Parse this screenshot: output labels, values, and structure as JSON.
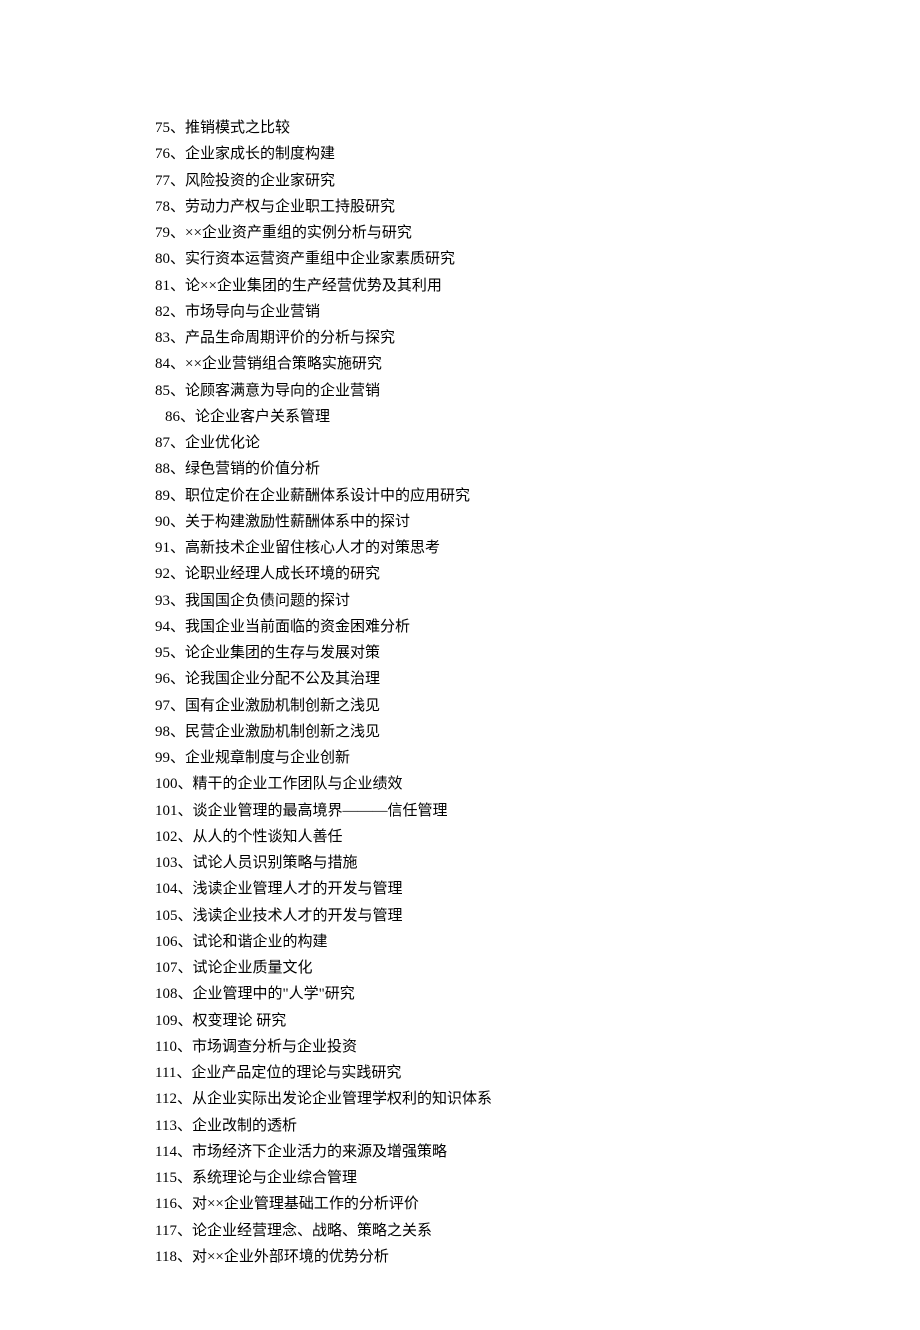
{
  "items": [
    {
      "num": "75",
      "text": "推销模式之比较"
    },
    {
      "num": "76",
      "text": "企业家成长的制度构建"
    },
    {
      "num": "77",
      "text": "风险投资的企业家研究"
    },
    {
      "num": "78",
      "text": "劳动力产权与企业职工持股研究"
    },
    {
      "num": "79",
      "text": "××企业资产重组的实例分析与研究"
    },
    {
      "num": "80",
      "text": "实行资本运营资产重组中企业家素质研究"
    },
    {
      "num": "81",
      "text": "论××企业集团的生产经营优势及其利用"
    },
    {
      "num": "82",
      "text": "市场导向与企业营销"
    },
    {
      "num": "83",
      "text": "产品生命周期评价的分析与探究"
    },
    {
      "num": "84",
      "text": "××企业营销组合策略实施研究"
    },
    {
      "num": "85",
      "text": "论顾客满意为导向的企业营销"
    },
    {
      "num": "86",
      "text": "论企业客户关系管理",
      "indent": true
    },
    {
      "num": "87",
      "text": "企业优化论"
    },
    {
      "num": "88",
      "text": "绿色营销的价值分析"
    },
    {
      "num": "89",
      "text": "职位定价在企业薪酬体系设计中的应用研究"
    },
    {
      "num": "90",
      "text": "关于构建激励性薪酬体系中的探讨"
    },
    {
      "num": "91",
      "text": "高新技术企业留住核心人才的对策思考"
    },
    {
      "num": "92",
      "text": "论职业经理人成长环境的研究"
    },
    {
      "num": "93",
      "text": "我国国企负债问题的探讨"
    },
    {
      "num": "94",
      "text": "我国企业当前面临的资金困难分析"
    },
    {
      "num": "95",
      "text": "论企业集团的生存与发展对策"
    },
    {
      "num": "96",
      "text": "论我国企业分配不公及其治理"
    },
    {
      "num": "97",
      "text": "国有企业激励机制创新之浅见"
    },
    {
      "num": "98",
      "text": "民营企业激励机制创新之浅见"
    },
    {
      "num": "99",
      "text": "企业规章制度与企业创新"
    },
    {
      "num": "100",
      "text": "精干的企业工作团队与企业绩效"
    },
    {
      "num": "101",
      "text": "谈企业管理的最高境界———信任管理"
    },
    {
      "num": "102",
      "text": "从人的个性谈知人善任"
    },
    {
      "num": "103",
      "text": "试论人员识别策略与措施"
    },
    {
      "num": "104",
      "text": "浅读企业管理人才的开发与管理"
    },
    {
      "num": "105",
      "text": "浅读企业技术人才的开发与管理"
    },
    {
      "num": "106",
      "text": "试论和谐企业的构建"
    },
    {
      "num": "107",
      "text": "试论企业质量文化"
    },
    {
      "num": "108",
      "text": "企业管理中的\"人学\"研究"
    },
    {
      "num": "109",
      "text": "权变理论 研究"
    },
    {
      "num": "110",
      "text": "市场调查分析与企业投资"
    },
    {
      "num": "111",
      "text": "企业产品定位的理论与实践研究"
    },
    {
      "num": "112",
      "text": "从企业实际出发论企业管理学权利的知识体系"
    },
    {
      "num": "113",
      "text": "企业改制的透析"
    },
    {
      "num": "114",
      "text": "市场经济下企业活力的来源及增强策略"
    },
    {
      "num": "115",
      "text": "系统理论与企业综合管理"
    },
    {
      "num": "116",
      "text": "对××企业管理基础工作的分析评价"
    },
    {
      "num": "117",
      "text": "论企业经营理念、战略、策略之关系"
    },
    {
      "num": "118",
      "text": "对××企业外部环境的优势分析"
    }
  ]
}
